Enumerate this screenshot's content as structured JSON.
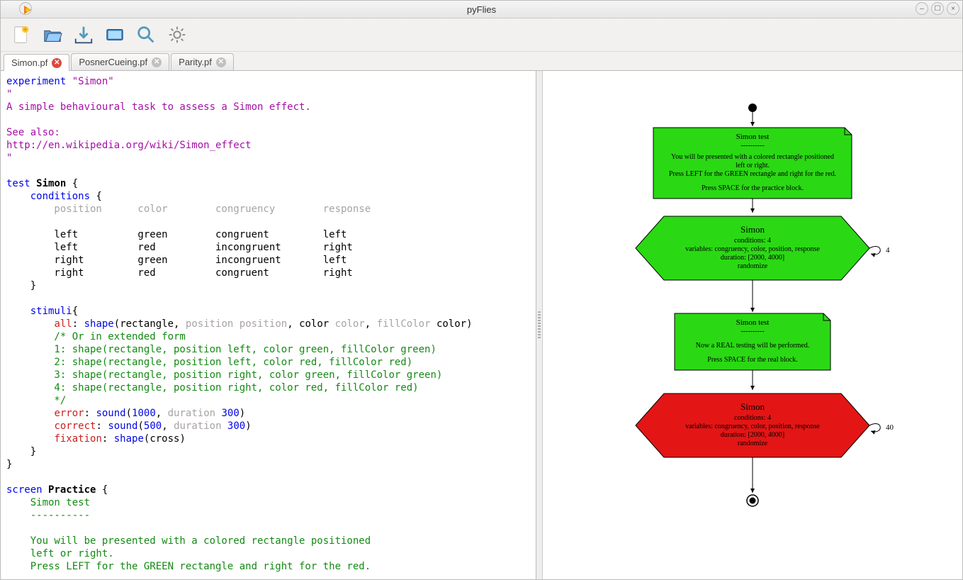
{
  "window": {
    "title": "pyFlies"
  },
  "toolbar": {
    "new": "New",
    "open": "Open",
    "save": "Save",
    "run": "Run",
    "zoom": "Zoom",
    "prefs": "Preferences"
  },
  "tabs": [
    {
      "label": "Simon.pf",
      "error": true
    },
    {
      "label": "PosnerCueing.pf",
      "error": false
    },
    {
      "label": "Parity.pf",
      "error": false
    }
  ],
  "code": {
    "l1a": "experiment ",
    "l1b": "\"Simon\"",
    "l2": "\"",
    "l3": "A simple behavioural task to assess a Simon effect.",
    "l4": "",
    "l5": "See also:",
    "l6": "http://en.wikipedia.org/wiki/Simon_effect",
    "l7": "\"",
    "l8": "",
    "l9a": "test ",
    "l9b": "Simon",
    "l9c": " {",
    "l10a": "    ",
    "l10b": "conditions",
    "l10c": " {",
    "l11": "        position      color        congruency        response",
    "l12": "",
    "l13": "        left          green        congruent         left",
    "l14": "        left          red          incongruent       right",
    "l15": "        right         green        incongruent       left",
    "l16": "        right         red          congruent         right",
    "l17": "    }",
    "l18": "",
    "l19a": "    ",
    "l19b": "stimuli",
    "l19c": "{",
    "l20a": "        ",
    "l20b": "all",
    "l20c": ": ",
    "l20d": "shape",
    "l20e": "(",
    "l20f": "rectangle",
    "l20g": ", ",
    "l20h": "position position",
    "l20i": ", ",
    "l20j": "color",
    "l20k": " color",
    "l20l": ", ",
    "l20m": "fillColor",
    "l20n": " color",
    "l20o": ")",
    "l21": "        /* Or in extended form",
    "l22": "        1: shape(rectangle, position left, color green, fillColor green)",
    "l23": "        2: shape(rectangle, position left, color red, fillColor red)",
    "l24": "        3: shape(rectangle, position right, color green, fillColor green)",
    "l25": "        4: shape(rectangle, position right, color red, fillColor red)",
    "l26": "        */",
    "l27a": "        ",
    "l27b": "error",
    "l27c": ": ",
    "l27d": "sound",
    "l27e": "(",
    "l27f": "1000",
    "l27g": ", ",
    "l27h": "duration ",
    "l27i": "300",
    "l27j": ")",
    "l28a": "        ",
    "l28b": "correct",
    "l28c": ": ",
    "l28d": "sound",
    "l28e": "(",
    "l28f": "500",
    "l28g": ", ",
    "l28h": "duration ",
    "l28i": "300",
    "l28j": ")",
    "l29a": "        ",
    "l29b": "fixation",
    "l29c": ": ",
    "l29d": "shape",
    "l29e": "(",
    "l29f": "cross",
    "l29g": ")",
    "l30": "    }",
    "l31": "}",
    "l32": "",
    "l33a": "screen ",
    "l33b": "Practice",
    "l33c": " {",
    "l34": "    Simon test",
    "l35": "    ----------",
    "l36": "",
    "l37": "    You will be presented with a colored rectangle positioned",
    "l38": "    left or right.",
    "l39": "    Press LEFT for the GREEN rectangle and right for the red."
  },
  "diagram": {
    "box1": {
      "title": "Simon test",
      "sep": "----------",
      "l1": "You will be presented with a colored rectangle positioned",
      "l2": "left or right.",
      "l3": "Press LEFT for the GREEN rectangle and right for the red.",
      "l4": "Press SPACE for the practice block."
    },
    "hex1": {
      "title": "Simon",
      "l1": "conditions: 4",
      "l2": "variables: congruency, color, position, response",
      "l3": "duration: [2000, 4000]",
      "l4": "randomize",
      "loop": "4"
    },
    "box2": {
      "title": "Simon test",
      "sep": "----------",
      "l1": "Now a REAL testing will be performed.",
      "l2": "Press SPACE for the real block."
    },
    "hex2": {
      "title": "Simon",
      "l1": "conditions: 4",
      "l2": "variables: congruency, color, position, response",
      "l3": "duration: [2000, 4000]",
      "l4": "randomize",
      "loop": "40"
    }
  }
}
